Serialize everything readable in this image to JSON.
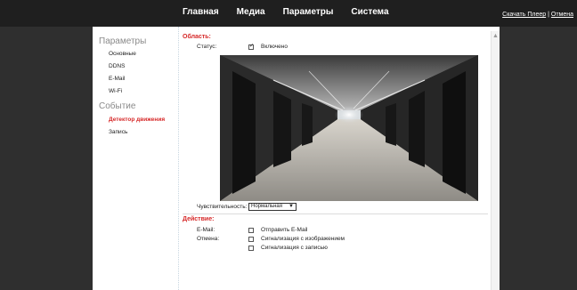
{
  "nav": {
    "items": [
      "Главная",
      "Медиа",
      "Параметры",
      "Система"
    ]
  },
  "top_links": {
    "download": "Скачать Плеер",
    "separator": "|",
    "cancel": "Отмена"
  },
  "sidebar": {
    "params_heading": "Параметры",
    "params_items": [
      "Основные",
      "DDNS",
      "E-Mail",
      "Wi-Fi"
    ],
    "event_heading": "Событие",
    "event_items": [
      "Детектор движения",
      "Запись"
    ],
    "active_item": "Детектор движения"
  },
  "area": {
    "title": "Область:",
    "status_label": "Статус:",
    "enabled_label": "Включено",
    "enabled_checked": true,
    "sensitivity_label": "Чувствительность:",
    "sensitivity_value": "Нормальная"
  },
  "action": {
    "title": "Действие:",
    "email_label": "E-Mail:",
    "cancel_label": "Отмена:",
    "send_email": "Отправить E-Mail",
    "alarm_image": "Сигнализация с изображением",
    "alarm_record": "Сигнализация с записью"
  },
  "colors": {
    "accent_red": "#d62828",
    "topbar": "#1f1f1f",
    "background": "#2b2b2b"
  },
  "icons": {
    "scroll_up": "chevron-up-icon",
    "select_arrow": "chevron-down-icon",
    "checkbox": "checkbox-icon"
  }
}
